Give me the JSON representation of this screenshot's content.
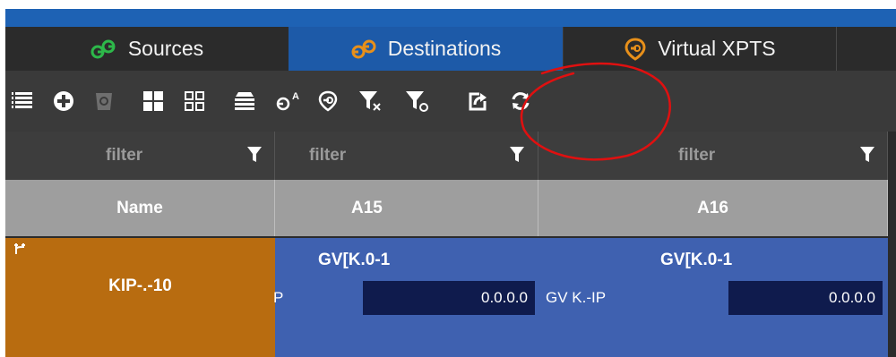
{
  "tabs": [
    {
      "label": "Sources",
      "icon": "sources-icon",
      "active": false
    },
    {
      "label": "Destinations",
      "icon": "destinations-icon",
      "active": true
    },
    {
      "label": "Virtual XPTS",
      "icon": "virtual-xpts-icon",
      "active": false
    }
  ],
  "toolbar": {
    "icons": [
      "list-icon",
      "add-icon",
      "delete-icon",
      "large-grid-icon",
      "small-grid-icon",
      "rows-icon",
      "destination-label-icon",
      "virtual-icon",
      "filter-clear-icon",
      "filter-reset-icon",
      "export-icon",
      "refresh-icon"
    ]
  },
  "filters": {
    "placeholder": "filter"
  },
  "columns": [
    "Name",
    "A15",
    "A16"
  ],
  "rows": [
    {
      "name": "KIP-.-10",
      "cells": [
        {
          "title": "GV[K.0-1",
          "label": "P",
          "value": "0.0.0.0"
        },
        {
          "title": "GV[K.0-1",
          "label": "GV K.-IP",
          "value": "0.0.0.0"
        }
      ]
    }
  ],
  "colors": {
    "topbar": "#1e62b4",
    "active_tab": "#1d5aa8",
    "toolbar_bg": "#3a3a3a",
    "header_bg": "#9e9e9e",
    "name_cell": "#b86c10",
    "data_cell": "#3f61b0",
    "value_box": "#0f1b4d",
    "annotation": "#e01010"
  }
}
